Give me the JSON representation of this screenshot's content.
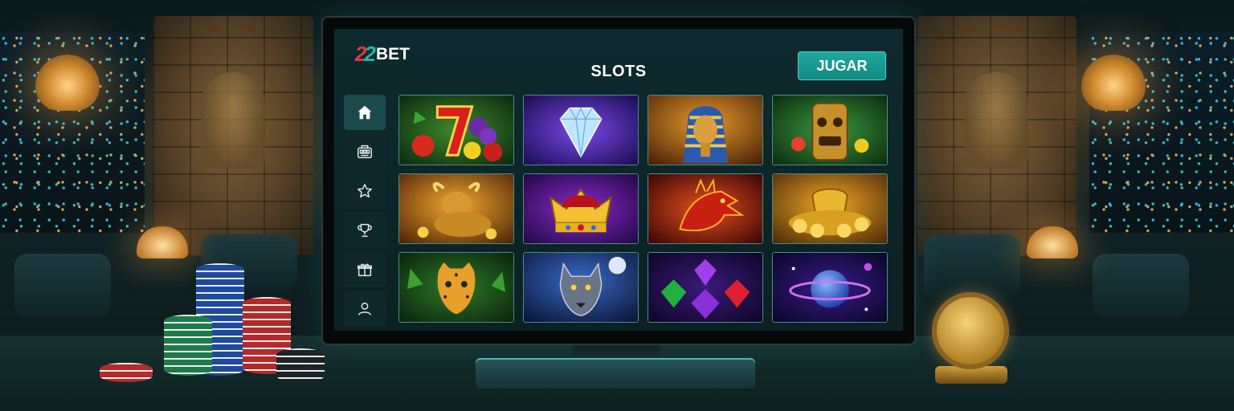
{
  "brand": {
    "number": "22",
    "name": "BET"
  },
  "page": {
    "title": "SLOTS"
  },
  "header": {
    "play_label": "JUGAR"
  },
  "colors": {
    "accent": "#1fb7b0",
    "logo_red": "#e23a3a",
    "screen_bg": "#0e2a2e"
  },
  "sidebar": {
    "items": [
      {
        "icon": "home-icon",
        "active": true
      },
      {
        "icon": "slot-machine-icon",
        "active": false
      },
      {
        "icon": "star-icon",
        "active": false
      },
      {
        "icon": "trophy-icon",
        "active": false
      },
      {
        "icon": "gift-icon",
        "active": false
      },
      {
        "icon": "user-icon",
        "active": false
      }
    ]
  },
  "games": [
    {
      "theme": "fruit-seven"
    },
    {
      "theme": "diamond"
    },
    {
      "theme": "pharaoh"
    },
    {
      "theme": "tiki-mask"
    },
    {
      "theme": "golden-bull"
    },
    {
      "theme": "royal-crown"
    },
    {
      "theme": "fire-dragon"
    },
    {
      "theme": "gold-treasure"
    },
    {
      "theme": "jungle-leopard"
    },
    {
      "theme": "moon-wolf"
    },
    {
      "theme": "gems"
    },
    {
      "theme": "cosmic-planet"
    }
  ]
}
